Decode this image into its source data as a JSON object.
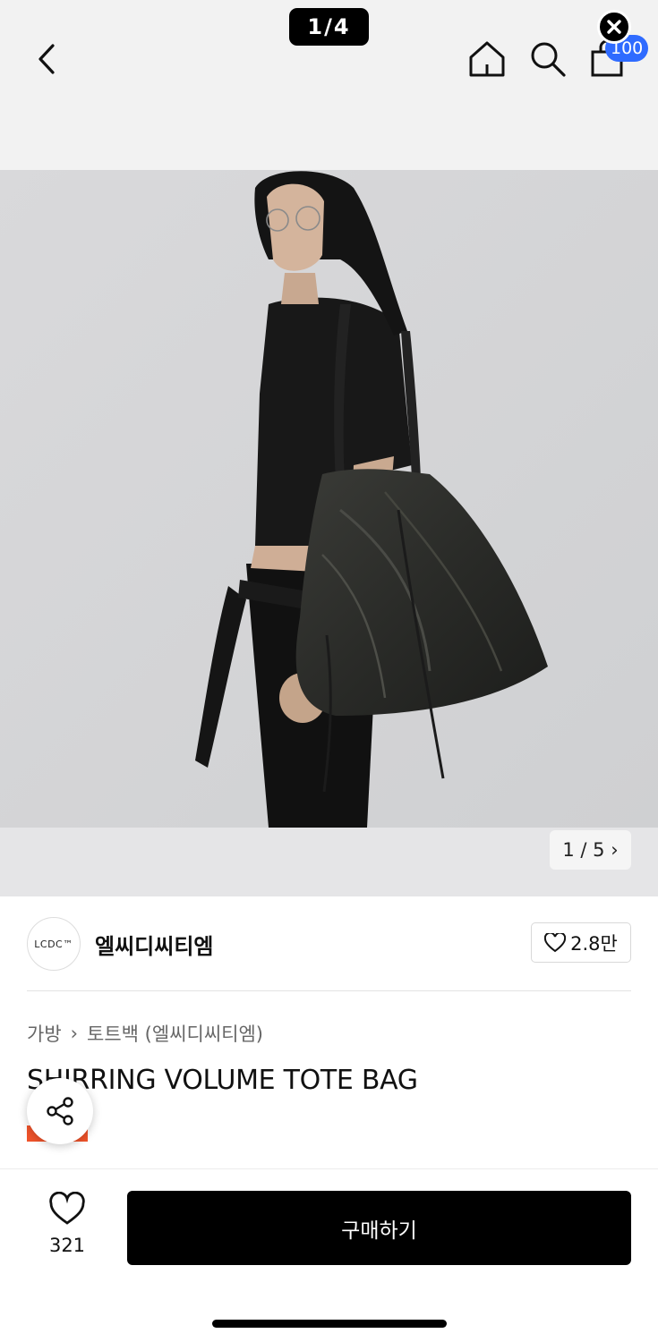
{
  "viewer": {
    "counter": "1/4"
  },
  "header": {
    "back_icon": "chevron-left-icon",
    "home_icon": "home-icon",
    "search_icon": "search-icon",
    "cart_icon": "bag-icon",
    "cart_badge": "100",
    "close_icon": "close-icon"
  },
  "gallery": {
    "image_counter": "1 / 5 ›"
  },
  "brand": {
    "logo_text": "LCDC™",
    "name": "엘씨디씨티엠",
    "likes": "2.8만"
  },
  "breadcrumb": {
    "category": "가방",
    "separator": "›",
    "subcategory": "토트백 (엘씨디씨티엠)"
  },
  "product": {
    "title": "SHIRRING VOLUME TOTE BAG"
  },
  "actions": {
    "like_count": "321",
    "buy_label": "구매하기"
  },
  "colors": {
    "header_bg": "#f2f2f2",
    "badge": "#2f6bff",
    "buy_button": "#000000",
    "tag": "#f0532a"
  }
}
